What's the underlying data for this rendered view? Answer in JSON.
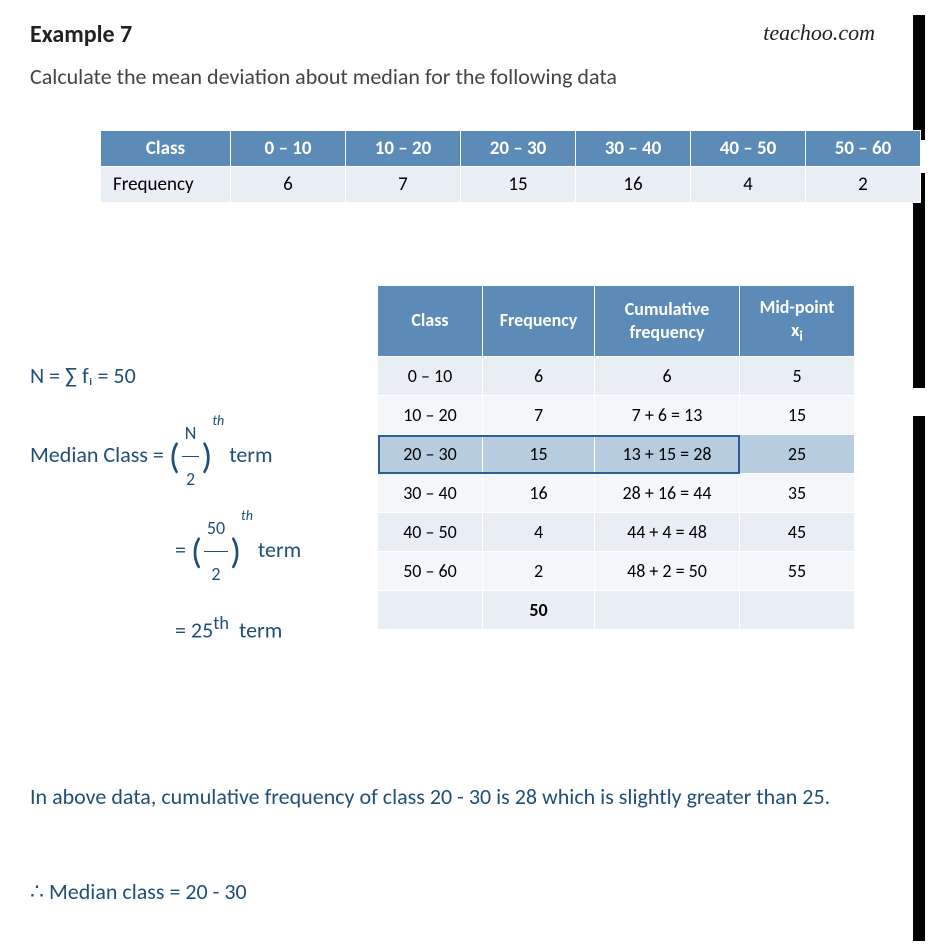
{
  "brand": "teachoo.com",
  "title": "Example 7",
  "question": "Calculate the mean deviation about median for the following data",
  "table1": {
    "headers": [
      "Class",
      "0 – 10",
      "10 – 20",
      "20 – 30",
      "30 – 40",
      "40 – 50",
      "50 – 60"
    ],
    "rowlabel": "Frequency",
    "freq": [
      "6",
      "7",
      "15",
      "16",
      "4",
      "2"
    ]
  },
  "steps": {
    "n_line": "N = ∑ fᵢ =  50",
    "mclass_label": "Median Class = ",
    "N": "N",
    "two": "2",
    "fifty": "50",
    "term": " term",
    "eq25": "= 25",
    "th_sup": "th"
  },
  "table2": {
    "headers": [
      "Class",
      "Frequency",
      "Cumulative frequency",
      "Mid-point xᵢ"
    ],
    "rows": [
      {
        "cls": "0 – 10",
        "f": "6",
        "cf": "6",
        "m": "5",
        "parity": "even",
        "hl": false
      },
      {
        "cls": "10 – 20",
        "f": "7",
        "cf": "7 + 6 = 13",
        "m": "15",
        "parity": "odd",
        "hl": false
      },
      {
        "cls": "20 – 30",
        "f": "15",
        "cf": "13 + 15 = 28",
        "m": "25",
        "parity": "even",
        "hl": true
      },
      {
        "cls": "30 – 40",
        "f": "16",
        "cf": "28 + 16 = 44",
        "m": "35",
        "parity": "odd",
        "hl": false
      },
      {
        "cls": "40 – 50",
        "f": "4",
        "cf": "44 + 4 = 48",
        "m": "45",
        "parity": "even",
        "hl": false
      },
      {
        "cls": "50 – 60",
        "f": "2",
        "cf": "48 + 2 = 50",
        "m": "55",
        "parity": "odd",
        "hl": false
      }
    ],
    "total": "50"
  },
  "concl1": "In above data, cumulative frequency of class 20 - 30 is 28 which is slightly greater than 25.",
  "concl2": "∴  Median class = 20 - 30",
  "chart_data": {
    "type": "table",
    "title": "Class frequency distribution",
    "columns": [
      "Class",
      "Frequency",
      "Cumulative frequency",
      "Mid-point"
    ],
    "rows": [
      [
        "0 – 10",
        6,
        6,
        5
      ],
      [
        "10 – 20",
        7,
        13,
        15
      ],
      [
        "20 – 30",
        15,
        28,
        25
      ],
      [
        "30 – 40",
        16,
        44,
        35
      ],
      [
        "40 – 50",
        4,
        48,
        45
      ],
      [
        "50 – 60",
        2,
        50,
        55
      ]
    ],
    "N": 50,
    "median_class": "20 – 30"
  }
}
